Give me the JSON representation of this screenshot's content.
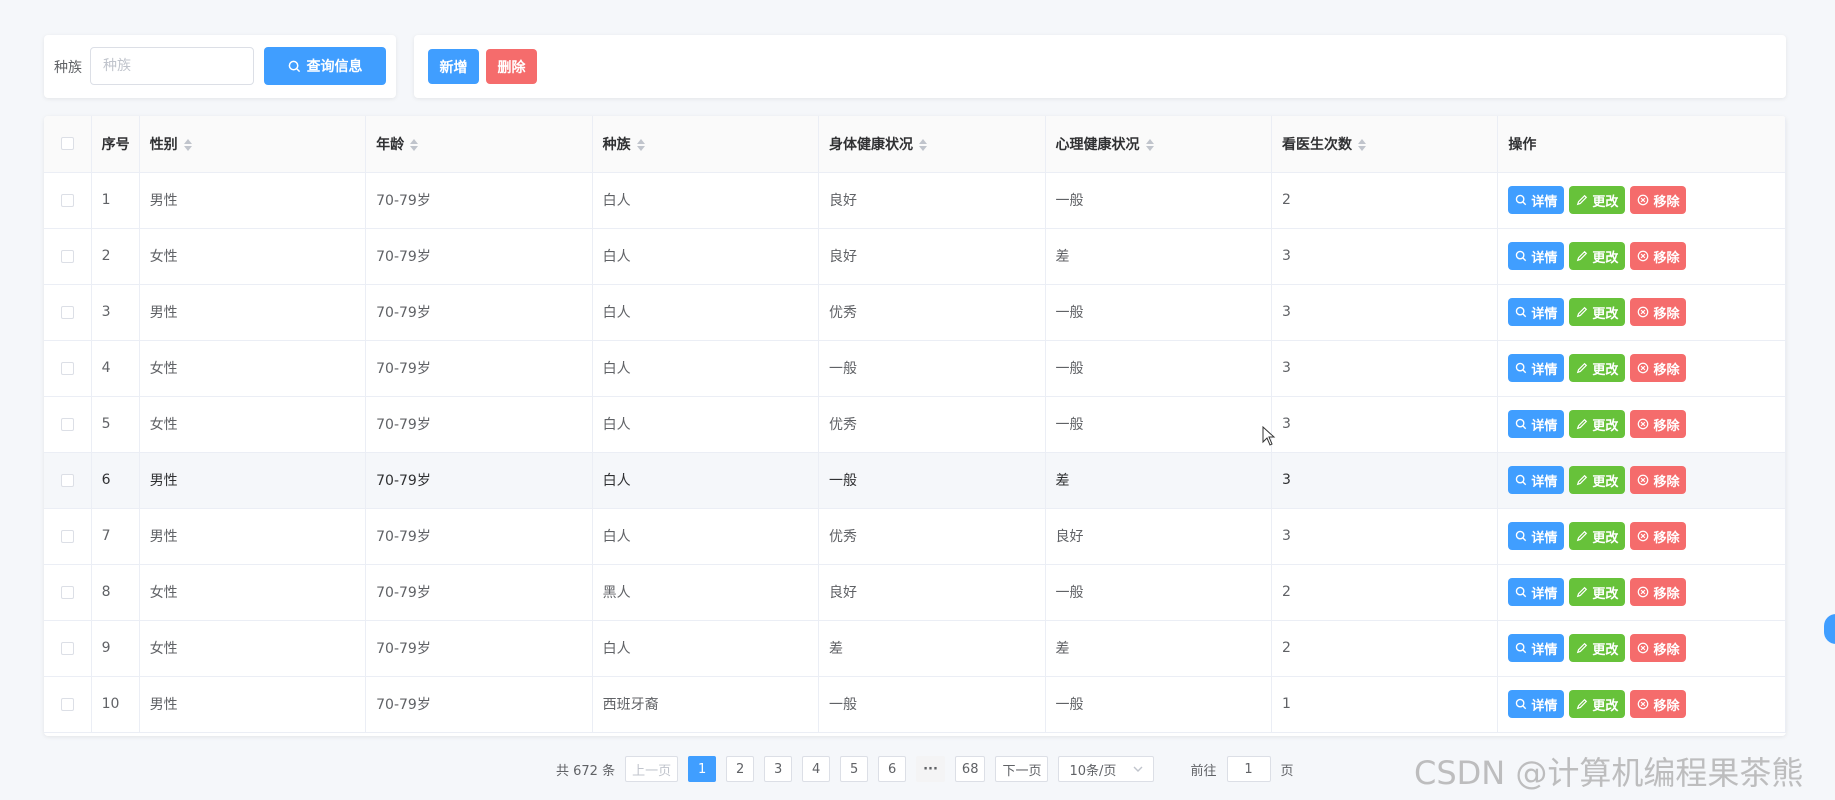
{
  "search": {
    "label": "种族",
    "placeholder": "种族",
    "value": "",
    "query_label": "查询信息"
  },
  "actions": {
    "add_label": "新增",
    "delete_label": "删除"
  },
  "table": {
    "headers": {
      "index": "序号",
      "gender": "性别",
      "age": "年龄",
      "race": "种族",
      "physical": "身体健康状况",
      "mental": "心理健康状况",
      "visits": "看医生次数",
      "ops": "操作"
    },
    "op_labels": {
      "detail": "详情",
      "edit": "更改",
      "remove": "移除"
    },
    "rows": [
      {
        "index": "1",
        "gender": "男性",
        "age": "70-79岁",
        "race": "白人",
        "physical": "良好",
        "mental": "一般",
        "visits": "2"
      },
      {
        "index": "2",
        "gender": "女性",
        "age": "70-79岁",
        "race": "白人",
        "physical": "良好",
        "mental": "差",
        "visits": "3"
      },
      {
        "index": "3",
        "gender": "男性",
        "age": "70-79岁",
        "race": "白人",
        "physical": "优秀",
        "mental": "一般",
        "visits": "3"
      },
      {
        "index": "4",
        "gender": "女性",
        "age": "70-79岁",
        "race": "白人",
        "physical": "一般",
        "mental": "一般",
        "visits": "3"
      },
      {
        "index": "5",
        "gender": "女性",
        "age": "70-79岁",
        "race": "白人",
        "physical": "优秀",
        "mental": "一般",
        "visits": "3"
      },
      {
        "index": "6",
        "gender": "男性",
        "age": "70-79岁",
        "race": "白人",
        "physical": "一般",
        "mental": "差",
        "visits": "3"
      },
      {
        "index": "7",
        "gender": "男性",
        "age": "70-79岁",
        "race": "白人",
        "physical": "优秀",
        "mental": "良好",
        "visits": "3"
      },
      {
        "index": "8",
        "gender": "女性",
        "age": "70-79岁",
        "race": "黑人",
        "physical": "良好",
        "mental": "一般",
        "visits": "2"
      },
      {
        "index": "9",
        "gender": "女性",
        "age": "70-79岁",
        "race": "白人",
        "physical": "差",
        "mental": "差",
        "visits": "2"
      },
      {
        "index": "10",
        "gender": "男性",
        "age": "70-79岁",
        "race": "西班牙裔",
        "physical": "一般",
        "mental": "一般",
        "visits": "1"
      }
    ],
    "hovered_row": 6
  },
  "pagination": {
    "total_text": "共 672 条",
    "prev_label": "上一页",
    "pages": [
      "1",
      "2",
      "3",
      "4",
      "5",
      "6"
    ],
    "current_page": "1",
    "more": "···",
    "last_page": "68",
    "next_label": "下一页",
    "page_size": "10条/页",
    "goto_label": "前往",
    "goto_value": "1",
    "page_unit": "页"
  },
  "watermark": "CSDN @计算机编程果茶熊",
  "colors": {
    "primary": "#409eff",
    "success": "#67c23a",
    "danger": "#f56c6c"
  }
}
